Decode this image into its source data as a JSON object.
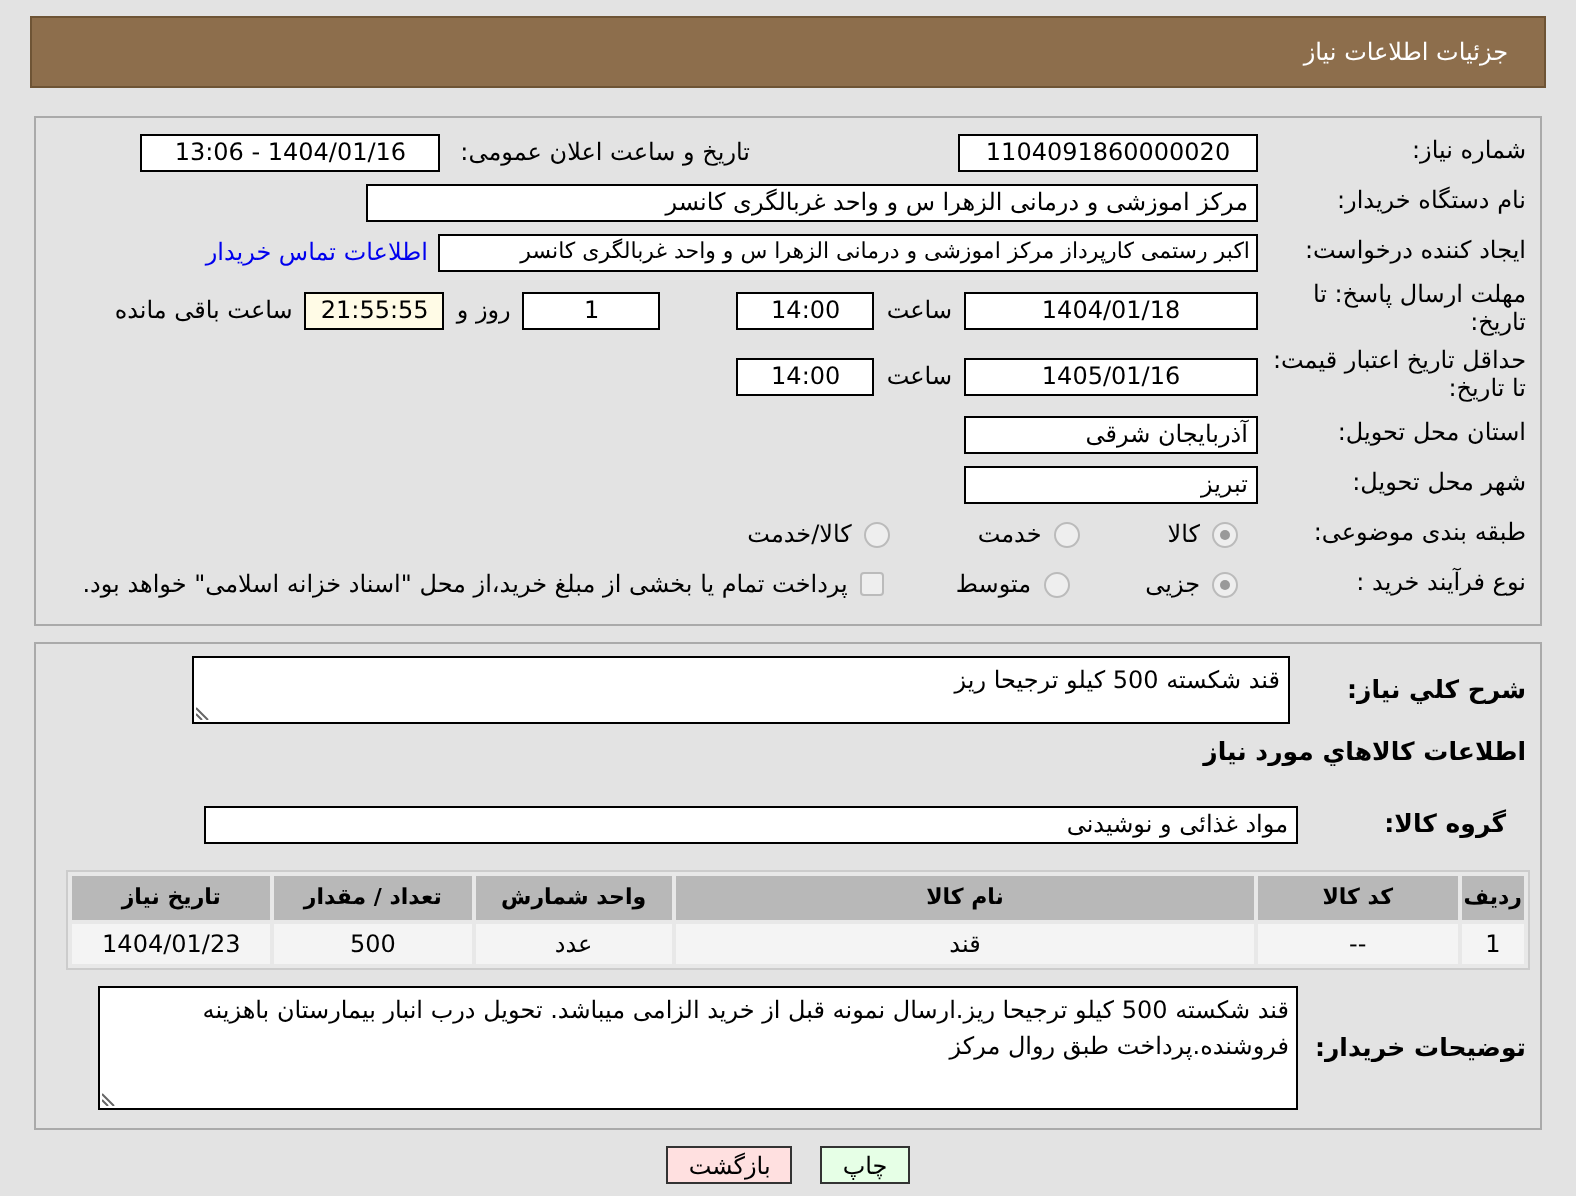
{
  "page_title": "جزئیات اطلاعات نیاز",
  "need_number": {
    "label": "شماره نیاز:",
    "value": "1104091860000020"
  },
  "announce": {
    "label": "تاریخ و ساعت اعلان عمومی:",
    "value": "1404/01/16 - 13:06"
  },
  "buyer_org": {
    "label": "نام دستگاه خریدار:",
    "value": "مرکز اموزشی و درمانی الزهرا س  و واحد غربالگری کانسر"
  },
  "requester": {
    "label": "ایجاد کننده درخواست:",
    "value": "اکبر رستمی کارپرداز مرکز اموزشی و درمانی الزهرا س  و واحد غربالگری کانسر",
    "link": "اطلاعات تماس خریدار"
  },
  "reply_deadline": {
    "label": "مهلت ارسال پاسخ: تا تاریخ:",
    "date": "1404/01/18",
    "time_label": "ساعت",
    "time": "14:00",
    "days": "1",
    "days_label": "روز و",
    "remaining": "21:55:55",
    "remaining_label": "ساعت باقی مانده"
  },
  "price_validity": {
    "label": "حداقل تاریخ اعتبار قیمت: تا تاریخ:",
    "date": "1405/01/16",
    "time_label": "ساعت",
    "time": "14:00"
  },
  "province": {
    "label": "استان محل تحویل:",
    "value": "آذربایجان شرقی"
  },
  "city": {
    "label": "شهر محل تحویل:",
    "value": "تبریز"
  },
  "category": {
    "label": "طبقه بندی موضوعی:",
    "options": [
      {
        "label": "کالا",
        "selected": true
      },
      {
        "label": "خدمت",
        "selected": false
      },
      {
        "label": "کالا/خدمت",
        "selected": false
      }
    ]
  },
  "purchase_type": {
    "label": "نوع فرآیند خرید :",
    "options": [
      {
        "label": "جزیی",
        "selected": true
      },
      {
        "label": "متوسط",
        "selected": false
      }
    ],
    "payment_note": {
      "label": "پرداخت تمام یا بخشی از مبلغ خرید،از محل \"اسناد خزانه اسلامی\" خواهد بود.",
      "checked": false
    }
  },
  "description": {
    "label": "شرح کلي نياز:",
    "value": "قند شکسته 500 کیلو ترجیحا ریز"
  },
  "items_heading": "اطلاعات کالاهاي مورد نياز",
  "goods_group": {
    "label": "گروه کالا:",
    "value": "مواد غذائی و نوشیدنی"
  },
  "table": {
    "columns": [
      "ردیف",
      "کد کالا",
      "نام کالا",
      "واحد شمارش",
      "تعداد / مقدار",
      "تاریخ نیاز"
    ],
    "rows": [
      [
        "1",
        "--",
        "قند",
        "عدد",
        "500",
        "1404/01/23"
      ]
    ]
  },
  "buyer_notes": {
    "label": "توضیحات خریدار:",
    "value": "قند شکسته 500 کیلو ترجیحا ریز.ارسال نمونه قبل از خرید الزامی میباشد. تحویل درب انبار بیمارستان باهزینه فروشنده.پرداخت طبق روال مرکز"
  },
  "buttons": [
    {
      "label": "چاپ",
      "kind": "print"
    },
    {
      "label": "بازگشت",
      "kind": "back"
    }
  ]
}
